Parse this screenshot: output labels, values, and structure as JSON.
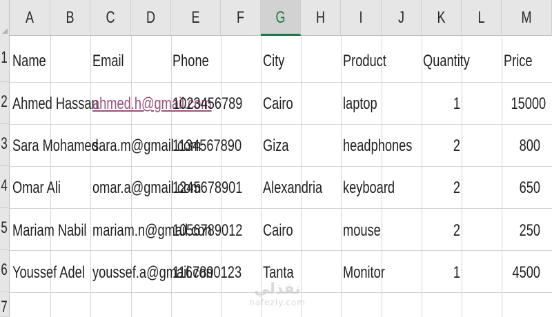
{
  "columns": [
    "A",
    "B",
    "C",
    "D",
    "E",
    "F",
    "G",
    "H",
    "I",
    "J",
    "K",
    "L",
    "M"
  ],
  "rows": [
    "1",
    "2",
    "3",
    "4",
    "5",
    "6",
    "7"
  ],
  "header": {
    "name": "Name",
    "email": "Email",
    "phone": "Phone",
    "city": "City",
    "product": "Product",
    "quantity": "Quantity",
    "price": "Price"
  },
  "records": [
    {
      "name": "Ahmed Hassan",
      "email": "ahmed.h@gmail.com",
      "phone": "1023456789",
      "city": "Cairo",
      "product": "laptop",
      "quantity": "1",
      "price": "15000"
    },
    {
      "name": "Sara Mohamed",
      "email": "sara.m@gmail.com",
      "phone": "1134567890",
      "city": "Giza",
      "product": "headphones",
      "quantity": "2",
      "price": "800"
    },
    {
      "name": "Omar Ali",
      "email": "omar.a@gmail.com",
      "phone": "1245678901",
      "city": "Alexandria",
      "product": "keyboard",
      "quantity": "2",
      "price": "650"
    },
    {
      "name": "Mariam Nabil",
      "email": "mariam.n@gmail.con",
      "phone": "1056789012",
      "city": "Cairo",
      "product": "mouse",
      "quantity": "2",
      "price": "250"
    },
    {
      "name": "Youssef Adel",
      "email": "youssef.a@gmail.con",
      "phone": "1167890123",
      "city": "Tanta",
      "product": "Monitor",
      "quantity": "1",
      "price": "4500"
    }
  ],
  "selected_column": "G",
  "watermark": {
    "arabic": "نفذلي",
    "latin": "nafezly.com"
  },
  "colors": {
    "link": "#9b4f7c",
    "selected_column_accent": "#217346",
    "header_bg": "#e6e6e6"
  }
}
